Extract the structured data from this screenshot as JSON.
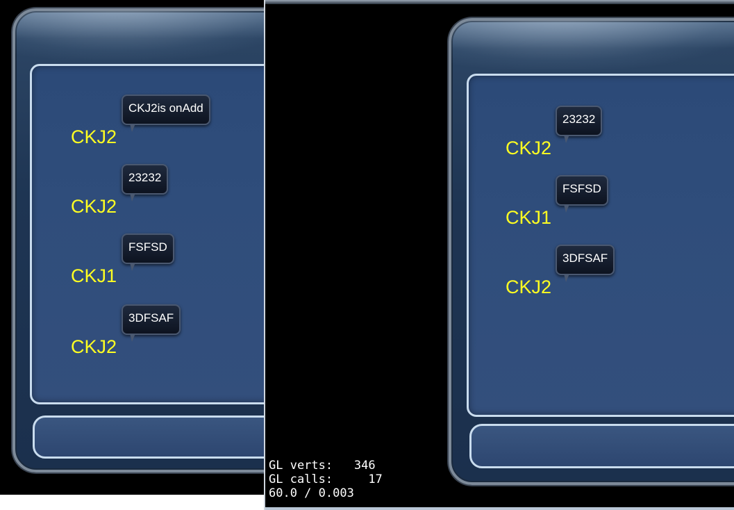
{
  "left_window": {
    "messages": [
      {
        "name": "CKJ2",
        "text": "CKJ2is onAdd"
      },
      {
        "name": "CKJ2",
        "text": "23232"
      },
      {
        "name": "CKJ1",
        "text": "FSFSD"
      },
      {
        "name": "CKJ2",
        "text": "3DFSAF"
      }
    ]
  },
  "right_window": {
    "messages": [
      {
        "name": "CKJ2",
        "text": "23232"
      },
      {
        "name": "CKJ1",
        "text": "FSFSD"
      },
      {
        "name": "CKJ2",
        "text": "3DFSAF"
      }
    ],
    "stats": {
      "verts_label": "GL verts:",
      "verts_value": "346",
      "calls_label": "GL calls:",
      "calls_value": "17",
      "fps_line": "60.0 / 0.003"
    }
  },
  "colors": {
    "name_text": "#ffff22",
    "bubble_bg": "#111a2a",
    "panel_border": "#c9dcee"
  }
}
